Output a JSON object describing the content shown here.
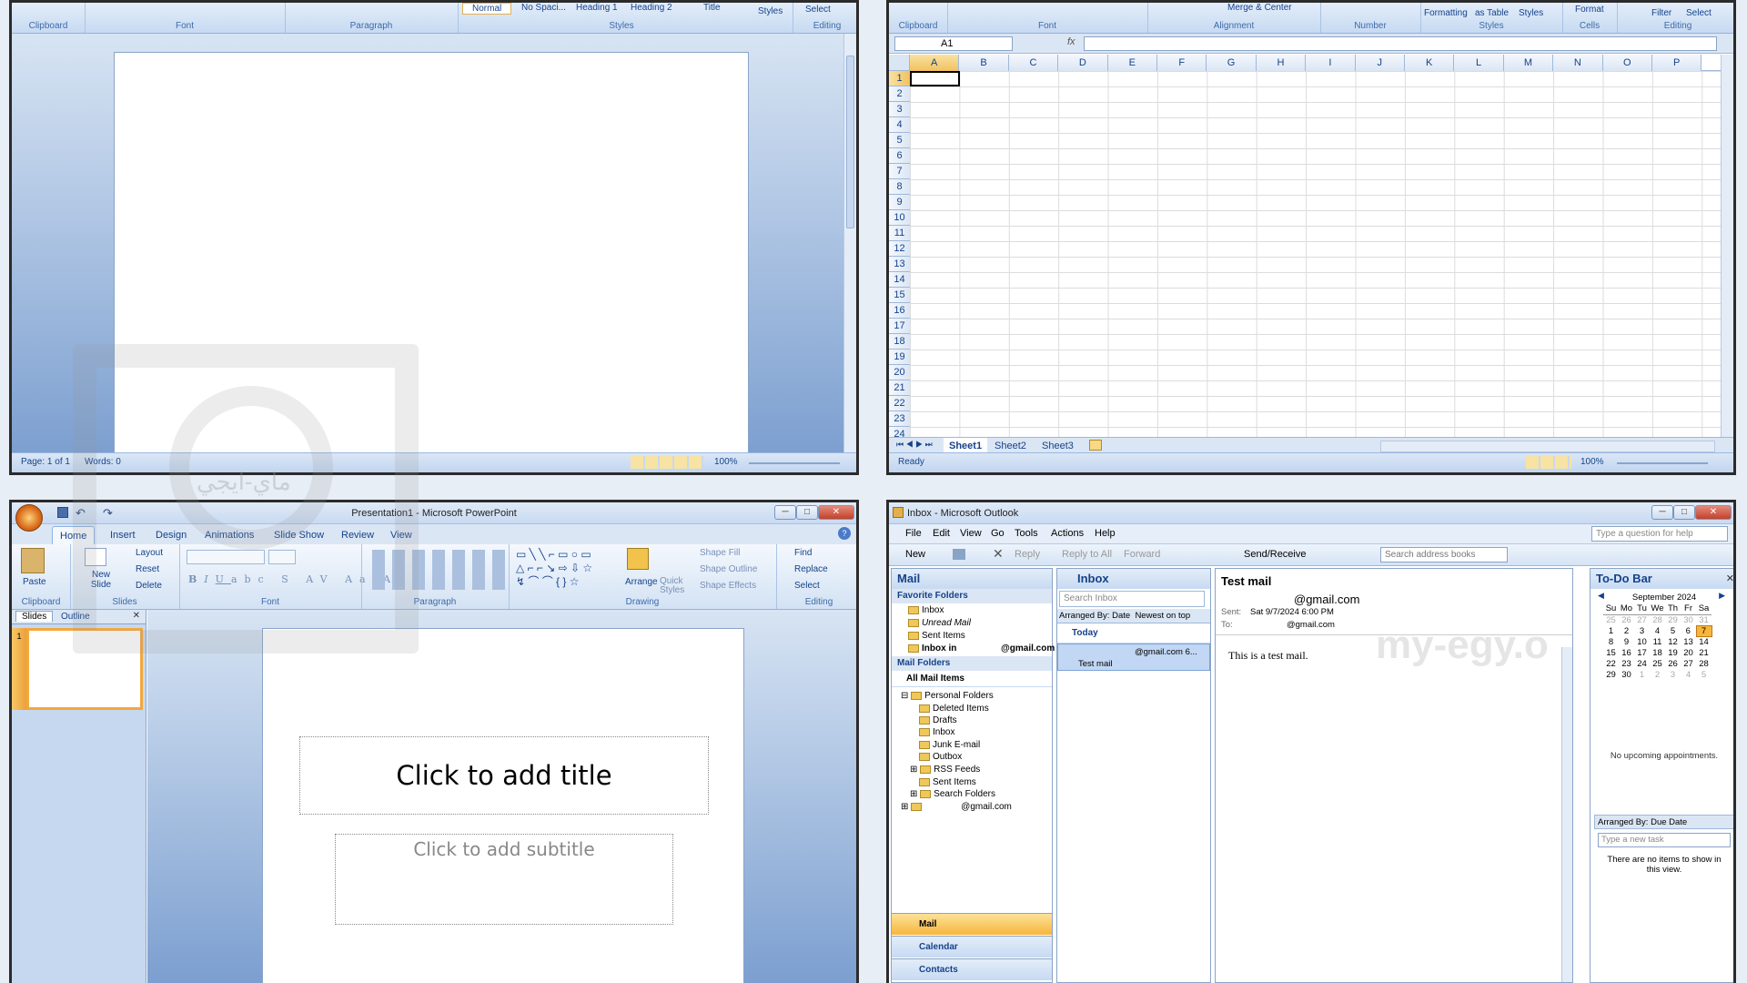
{
  "word": {
    "groups": [
      "Clipboard",
      "Font",
      "Paragraph",
      "Styles",
      "Editing"
    ],
    "style_quick": [
      "Normal",
      "No Spaci...",
      "Heading 1",
      "Heading 2",
      "Title"
    ],
    "styles_btn": "Styles",
    "select_btn": "Select",
    "status": {
      "page": "Page: 1 of 1",
      "words": "Words: 0",
      "zoom": "100%"
    }
  },
  "excel": {
    "groups": [
      "Clipboard",
      "Font",
      "Alignment",
      "Number",
      "Styles",
      "Cells",
      "Editing"
    ],
    "top_btns": {
      "merge": "Merge & Center",
      "formatting": "Formatting",
      "as_table": "as Table",
      "styles": "Styles",
      "format": "Format",
      "filter": "Filter",
      "select": "Select"
    },
    "name_box": "A1",
    "fx": "fx",
    "columns": [
      "A",
      "B",
      "C",
      "D",
      "E",
      "F",
      "G",
      "H",
      "I",
      "J",
      "K",
      "L",
      "M",
      "N",
      "O",
      "P"
    ],
    "rows": [
      "1",
      "2",
      "3",
      "4",
      "5",
      "6",
      "7",
      "8",
      "9",
      "10",
      "11",
      "12",
      "13",
      "14",
      "15",
      "16",
      "17",
      "18",
      "19",
      "20",
      "21",
      "22",
      "23",
      "24"
    ],
    "sheets": [
      "Sheet1",
      "Sheet2",
      "Sheet3"
    ],
    "status": {
      "ready": "Ready",
      "zoom": "100%"
    }
  },
  "ppt": {
    "title": "Presentation1 - Microsoft PowerPoint",
    "tabs": [
      "Home",
      "Insert",
      "Design",
      "Animations",
      "Slide Show",
      "Review",
      "View"
    ],
    "slides_btns": {
      "paste": "Paste",
      "new_slide": "New Slide",
      "layout": "Layout",
      "reset": "Reset",
      "delete": "Delete"
    },
    "drawing_btns": {
      "arrange": "Arrange",
      "quick_styles": "Quick Styles",
      "shape_fill": "Shape Fill",
      "shape_outline": "Shape Outline",
      "shape_effects": "Shape Effects"
    },
    "editing_btns": {
      "find": "Find",
      "replace": "Replace",
      "select": "Select"
    },
    "groups": [
      "Clipboard",
      "Slides",
      "Font",
      "Paragraph",
      "Drawing",
      "Editing"
    ],
    "panel_tabs": [
      "Slides",
      "Outline"
    ],
    "slide_num": "1",
    "placeholder_title": "Click to add title",
    "placeholder_subtitle": "Click to add subtitle"
  },
  "outlook": {
    "title": "Inbox - Microsoft Outlook",
    "menu": [
      "File",
      "Edit",
      "View",
      "Go",
      "Tools",
      "Actions",
      "Help"
    ],
    "help_placeholder": "Type a question for help",
    "toolbar": {
      "new": "New",
      "reply": "Reply",
      "reply_all": "Reply to All",
      "forward": "Forward",
      "send_receive": "Send/Receive",
      "search_books": "Search address books"
    },
    "nav": {
      "header": "Mail",
      "fav_header": "Favorite Folders",
      "favorites": [
        "Inbox",
        "Unread Mail",
        "Sent Items",
        "Inbox in"
      ],
      "fav_account": "@gmail.com",
      "mail_folders": "Mail Folders",
      "all_items": "All Mail Items",
      "personal": "Personal Folders",
      "folders": [
        "Deleted Items",
        "Drafts",
        "Inbox",
        "Junk E-mail",
        "Outbox",
        "RSS Feeds",
        "Sent Items",
        "Search Folders"
      ],
      "account": "@gmail.com",
      "bottom": [
        "Mail",
        "Calendar",
        "Contacts"
      ]
    },
    "inbox": {
      "header": "Inbox",
      "search_placeholder": "Search Inbox",
      "arranged": "Arranged By: Date",
      "order": "Newest on top",
      "group": "Today",
      "msg_from": "@gmail.com 6...",
      "msg_subject": "Test mail"
    },
    "reading": {
      "subject": "Test mail",
      "from": "@gmail.com",
      "sent_label": "Sent:",
      "sent": "Sat 9/7/2024 6:00 PM",
      "to_label": "To:",
      "to": "@gmail.com",
      "body": "This is a test mail."
    },
    "todo": {
      "header": "To-Do Bar",
      "month": "September 2024",
      "weekdays": [
        "Su",
        "Mo",
        "Tu",
        "We",
        "Th",
        "Fr",
        "Sa"
      ],
      "weeks": [
        [
          "25",
          "26",
          "27",
          "28",
          "29",
          "30",
          "31"
        ],
        [
          "1",
          "2",
          "3",
          "4",
          "5",
          "6",
          "7"
        ],
        [
          "8",
          "9",
          "10",
          "11",
          "12",
          "13",
          "14"
        ],
        [
          "15",
          "16",
          "17",
          "18",
          "19",
          "20",
          "21"
        ],
        [
          "22",
          "23",
          "24",
          "25",
          "26",
          "27",
          "28"
        ],
        [
          "29",
          "30",
          "1",
          "2",
          "3",
          "4",
          "5"
        ]
      ],
      "no_appts": "No upcoming appointments.",
      "arranged": "Arranged By: Due Date",
      "task_placeholder": "Type a new task",
      "no_items": "There are no items to show in this view."
    }
  },
  "watermark": {
    "logo_text": "ماي-ايجي",
    "url": "my-egy.o"
  }
}
